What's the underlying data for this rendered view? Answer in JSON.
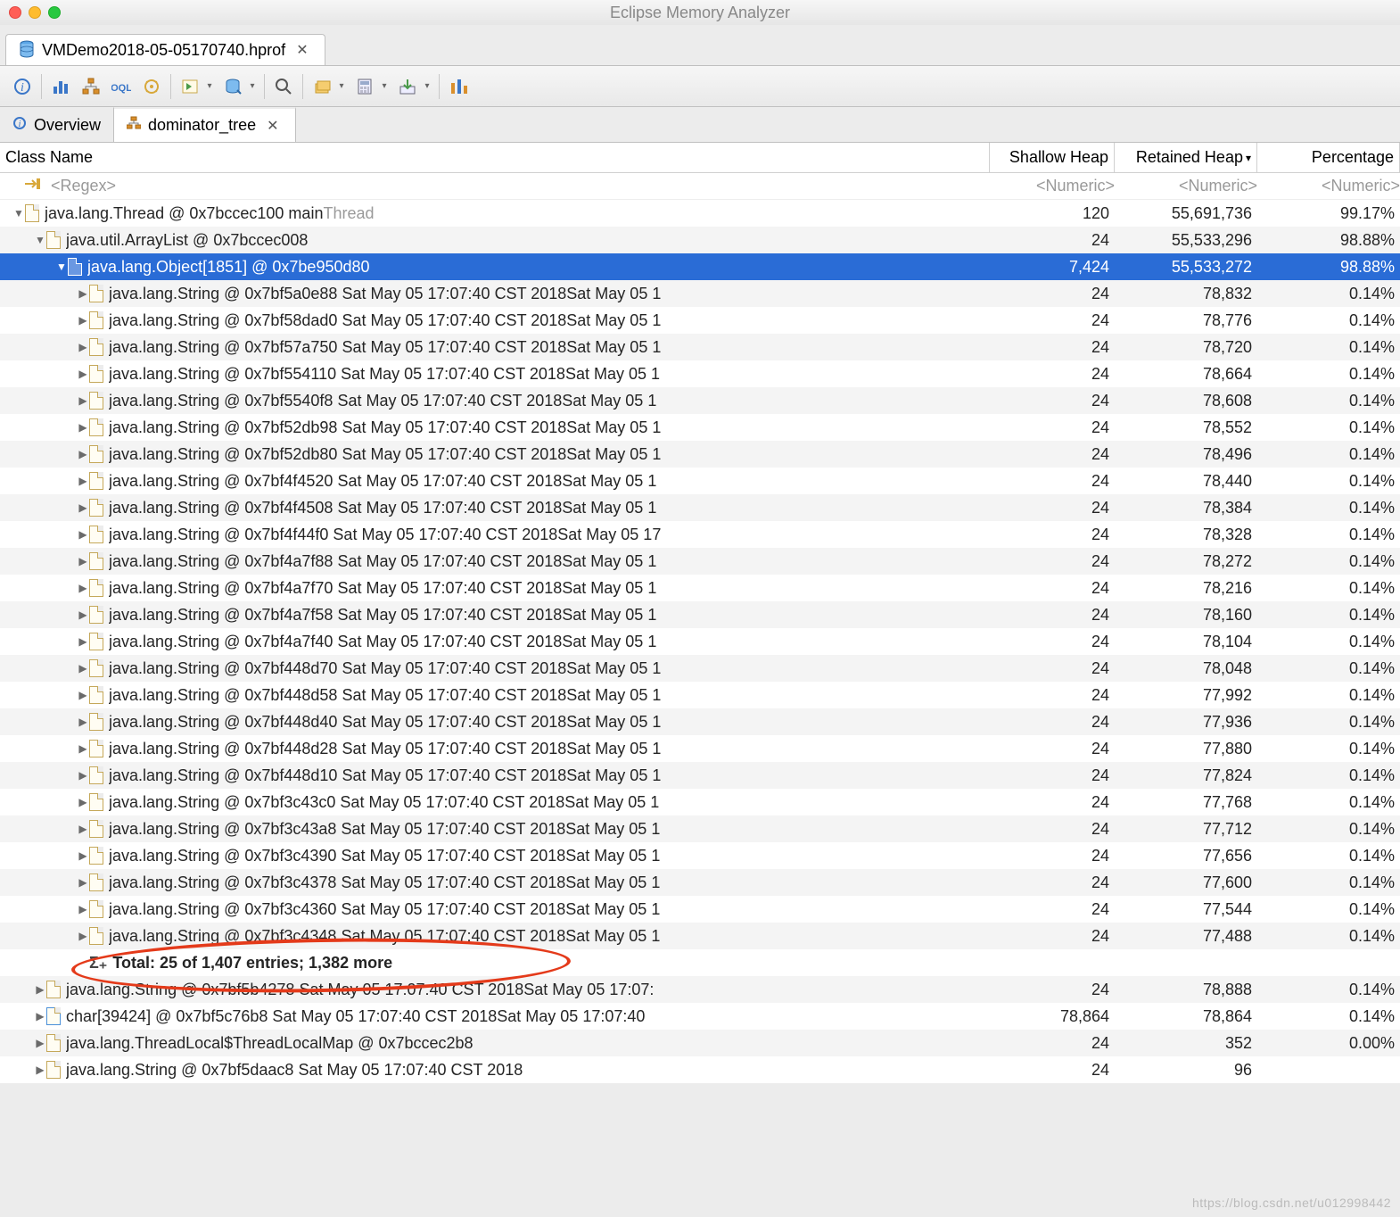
{
  "window": {
    "title": "Eclipse Memory Analyzer"
  },
  "file_tab": {
    "label": "VMDemo2018-05-05170740.hprof"
  },
  "inner_tabs": {
    "overview": "Overview",
    "dominator": "dominator_tree"
  },
  "columns": {
    "name": "Class Name",
    "shallow": "Shallow Heap",
    "retained": "Retained Heap",
    "retained_sort": "▾",
    "percent": "Percentage"
  },
  "filter": {
    "regex": "<Regex>",
    "numeric": "<Numeric>"
  },
  "tree": {
    "root": {
      "label": "java.lang.Thread @ 0x7bccec100  main",
      "suffix": "Thread",
      "shallow": "120",
      "retained": "55,691,736",
      "percent": "99.17%"
    },
    "arraylist": {
      "label": "java.util.ArrayList @ 0x7bccec008",
      "shallow": "24",
      "retained": "55,533,296",
      "percent": "98.88%"
    },
    "objectarray": {
      "label": "java.lang.Object[1851] @ 0x7be950d80",
      "shallow": "7,424",
      "retained": "55,533,272",
      "percent": "98.88%"
    },
    "strings": [
      {
        "label": "java.lang.String @ 0x7bf5a0e88  Sat May 05 17:07:40 CST 2018Sat May 05 1",
        "shallow": "24",
        "retained": "78,832",
        "percent": "0.14%"
      },
      {
        "label": "java.lang.String @ 0x7bf58dad0  Sat May 05 17:07:40 CST 2018Sat May 05 1",
        "shallow": "24",
        "retained": "78,776",
        "percent": "0.14%"
      },
      {
        "label": "java.lang.String @ 0x7bf57a750  Sat May 05 17:07:40 CST 2018Sat May 05 1",
        "shallow": "24",
        "retained": "78,720",
        "percent": "0.14%"
      },
      {
        "label": "java.lang.String @ 0x7bf554110  Sat May 05 17:07:40 CST 2018Sat May 05 1",
        "shallow": "24",
        "retained": "78,664",
        "percent": "0.14%"
      },
      {
        "label": "java.lang.String @ 0x7bf5540f8  Sat May 05 17:07:40 CST 2018Sat May 05 1",
        "shallow": "24",
        "retained": "78,608",
        "percent": "0.14%"
      },
      {
        "label": "java.lang.String @ 0x7bf52db98  Sat May 05 17:07:40 CST 2018Sat May 05 1",
        "shallow": "24",
        "retained": "78,552",
        "percent": "0.14%"
      },
      {
        "label": "java.lang.String @ 0x7bf52db80  Sat May 05 17:07:40 CST 2018Sat May 05 1",
        "shallow": "24",
        "retained": "78,496",
        "percent": "0.14%"
      },
      {
        "label": "java.lang.String @ 0x7bf4f4520  Sat May 05 17:07:40 CST 2018Sat May 05 1",
        "shallow": "24",
        "retained": "78,440",
        "percent": "0.14%"
      },
      {
        "label": "java.lang.String @ 0x7bf4f4508  Sat May 05 17:07:40 CST 2018Sat May 05 1",
        "shallow": "24",
        "retained": "78,384",
        "percent": "0.14%"
      },
      {
        "label": "java.lang.String @ 0x7bf4f44f0  Sat May 05 17:07:40 CST 2018Sat May 05 17",
        "shallow": "24",
        "retained": "78,328",
        "percent": "0.14%"
      },
      {
        "label": "java.lang.String @ 0x7bf4a7f88  Sat May 05 17:07:40 CST 2018Sat May 05 1",
        "shallow": "24",
        "retained": "78,272",
        "percent": "0.14%"
      },
      {
        "label": "java.lang.String @ 0x7bf4a7f70  Sat May 05 17:07:40 CST 2018Sat May 05 1",
        "shallow": "24",
        "retained": "78,216",
        "percent": "0.14%"
      },
      {
        "label": "java.lang.String @ 0x7bf4a7f58  Sat May 05 17:07:40 CST 2018Sat May 05 1",
        "shallow": "24",
        "retained": "78,160",
        "percent": "0.14%"
      },
      {
        "label": "java.lang.String @ 0x7bf4a7f40  Sat May 05 17:07:40 CST 2018Sat May 05 1",
        "shallow": "24",
        "retained": "78,104",
        "percent": "0.14%"
      },
      {
        "label": "java.lang.String @ 0x7bf448d70  Sat May 05 17:07:40 CST 2018Sat May 05 1",
        "shallow": "24",
        "retained": "78,048",
        "percent": "0.14%"
      },
      {
        "label": "java.lang.String @ 0x7bf448d58  Sat May 05 17:07:40 CST 2018Sat May 05 1",
        "shallow": "24",
        "retained": "77,992",
        "percent": "0.14%"
      },
      {
        "label": "java.lang.String @ 0x7bf448d40  Sat May 05 17:07:40 CST 2018Sat May 05 1",
        "shallow": "24",
        "retained": "77,936",
        "percent": "0.14%"
      },
      {
        "label": "java.lang.String @ 0x7bf448d28  Sat May 05 17:07:40 CST 2018Sat May 05 1",
        "shallow": "24",
        "retained": "77,880",
        "percent": "0.14%"
      },
      {
        "label": "java.lang.String @ 0x7bf448d10  Sat May 05 17:07:40 CST 2018Sat May 05 1",
        "shallow": "24",
        "retained": "77,824",
        "percent": "0.14%"
      },
      {
        "label": "java.lang.String @ 0x7bf3c43c0  Sat May 05 17:07:40 CST 2018Sat May 05 1",
        "shallow": "24",
        "retained": "77,768",
        "percent": "0.14%"
      },
      {
        "label": "java.lang.String @ 0x7bf3c43a8  Sat May 05 17:07:40 CST 2018Sat May 05 1",
        "shallow": "24",
        "retained": "77,712",
        "percent": "0.14%"
      },
      {
        "label": "java.lang.String @ 0x7bf3c4390  Sat May 05 17:07:40 CST 2018Sat May 05 1",
        "shallow": "24",
        "retained": "77,656",
        "percent": "0.14%"
      },
      {
        "label": "java.lang.String @ 0x7bf3c4378  Sat May 05 17:07:40 CST 2018Sat May 05 1",
        "shallow": "24",
        "retained": "77,600",
        "percent": "0.14%"
      },
      {
        "label": "java.lang.String @ 0x7bf3c4360  Sat May 05 17:07:40 CST 2018Sat May 05 1",
        "shallow": "24",
        "retained": "77,544",
        "percent": "0.14%"
      },
      {
        "label": "java.lang.String @ 0x7bf3c4348  Sat May 05 17:07:40 CST 2018Sat May 05 1",
        "shallow": "24",
        "retained": "77,488",
        "percent": "0.14%"
      }
    ],
    "total": "Total: 25 of 1,407 entries; 1,382 more",
    "siblings": [
      {
        "label": "java.lang.String @ 0x7bf5b4278  Sat May 05 17:07:40 CST 2018Sat May 05 17:07:",
        "shallow": "24",
        "retained": "78,888",
        "percent": "0.14%"
      },
      {
        "label": "char[39424] @ 0x7bf5c76b8  Sat May 05 17:07:40 CST 2018Sat May 05 17:07:40",
        "shallow": "78,864",
        "retained": "78,864",
        "percent": "0.14%",
        "char": true
      },
      {
        "label": "java.lang.ThreadLocal$ThreadLocalMap @ 0x7bccec2b8",
        "shallow": "24",
        "retained": "352",
        "percent": "0.00%"
      },
      {
        "label": "java.lang.String @ 0x7bf5daac8  Sat May 05 17:07:40 CST 2018",
        "shallow": "24",
        "retained": "96",
        "percent": "",
        "partial": true
      }
    ]
  },
  "watermark": "https://blog.csdn.net/u012998442"
}
